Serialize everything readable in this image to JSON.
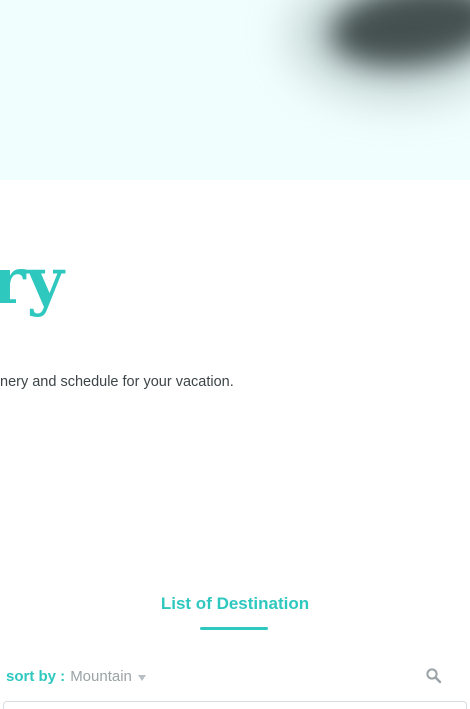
{
  "hero": {
    "headline_fragment": "ry",
    "tagline_fragment": "nery and schedule for your vacation."
  },
  "destinations": {
    "title": "List of Destination",
    "sort_label": "sort by :",
    "sort_value": "Mountain",
    "search_icon": "search-icon",
    "caret_icon": "caret-down-icon"
  },
  "colors": {
    "accent": "#2fc8bf",
    "hero_background": "#f0fffd",
    "body_text": "#3d4548",
    "muted_text": "#9aa3a6"
  }
}
